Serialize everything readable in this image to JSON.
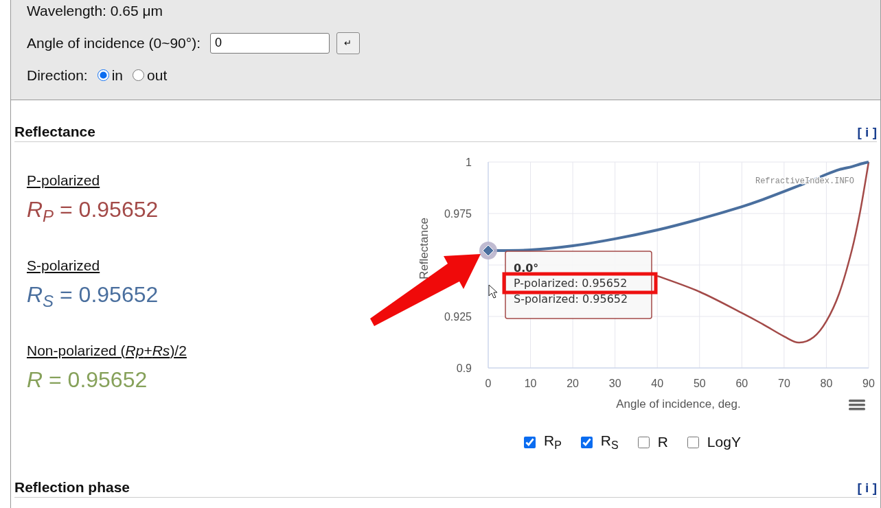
{
  "input_panel": {
    "wavelength": "Wavelength: 0.65 μm",
    "angle_label": "Angle of incidence (0~90°):",
    "angle_value": "0",
    "submit_button": "↵",
    "direction_label": "Direction:",
    "direction_options": [
      {
        "label": "in",
        "selected": true
      },
      {
        "label": "out",
        "selected": false
      }
    ]
  },
  "reflectance": {
    "title": "Reflectance",
    "info": "[ i ]",
    "results": [
      {
        "label": "P-polarized",
        "formula": "*R*$_{P}$ = 0.95652",
        "color": "#a34a48"
      },
      {
        "label": "S-polarized",
        "formula": "*R*$_{S}$ = 0.95652",
        "color": "#4a6f9e"
      },
      {
        "label": "Non-polarized (*Rp*+*Rs*)/2",
        "formula": "*R* = 0.95652",
        "color": "#86a15a"
      }
    ],
    "chart": {
      "chart_data": {
        "type": "line",
        "xlabel": "Angle of incidence, deg.",
        "ylabel": "Reflectance",
        "x": [
          0,
          10,
          20,
          30,
          40,
          50,
          60,
          65,
          70,
          73.5,
          77,
          80,
          83,
          86,
          88,
          90
        ],
        "series": [
          {
            "color": "#a34a48",
            "values": [
              null,
              null,
              null,
              null,
              0.9447,
              0.937,
              0.9267,
              0.9212,
              0.9153,
              0.9123,
              0.915,
              0.9227,
              0.936,
              0.957,
              0.976,
              1.0
            ]
          },
          {
            "color": "#4a6f9e",
            "values": [
              0.957,
              0.9573,
              0.9593,
              0.9627,
              0.967,
              0.9723,
              0.9783,
              0.9818,
              0.9857,
              0.9885,
              0.9913,
              0.994,
              0.9963,
              0.9977,
              0.999,
              1.0
            ]
          }
        ],
        "xlim": [
          0,
          90
        ],
        "ylim": [
          0.9,
          1
        ],
        "xticks": [
          0,
          10,
          20,
          30,
          40,
          50,
          60,
          70,
          80,
          90
        ],
        "yticks": [
          0.9,
          0.925,
          0.975,
          1
        ],
        "grid": true
      },
      "credits": "RefractiveIndex.INFO",
      "tooltip": {
        "title": "0.0°",
        "lines": [
          {
            "text": "P-polarized: 0.95652",
            "highlighted": true
          },
          {
            "text": "S-polarized: 0.95652",
            "highlighted": false
          }
        ]
      }
    },
    "toggles": [
      {
        "label": "R$_{P}$",
        "checked": true
      },
      {
        "label": "R$_{S}$",
        "checked": true
      },
      {
        "label": "R",
        "checked": false
      },
      {
        "label": "LogY",
        "checked": false
      }
    ]
  },
  "reflection_phase": {
    "title": "Reflection phase",
    "info": "[ i ]"
  }
}
